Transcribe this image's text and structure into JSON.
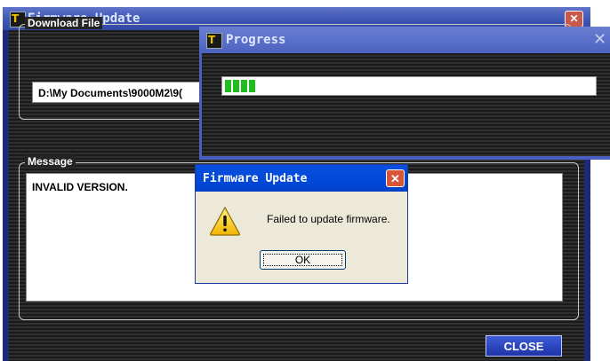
{
  "main_window": {
    "title": "Firmware Update",
    "close_symbol": "✕",
    "download_group_label": "Download File",
    "download_path": "D:\\My Documents\\9000M2\\9(",
    "message_group_label": "Message",
    "message_text": "INVALID VERSION.",
    "close_button_label": "CLOSE"
  },
  "progress_window": {
    "title": "Progress",
    "close_symbol": "✕",
    "progress_fraction": 0.12
  },
  "dialog": {
    "title": "Firmware Update",
    "close_symbol": "✕",
    "message": "Failed to update firmware.",
    "ok_label": "OK",
    "icon": "warning-icon"
  },
  "app_logo_glyph": "T",
  "colors": {
    "progress_green": "#1fbd1f",
    "xp_title_blue": "#0048d8",
    "close_red": "#d8553a"
  }
}
